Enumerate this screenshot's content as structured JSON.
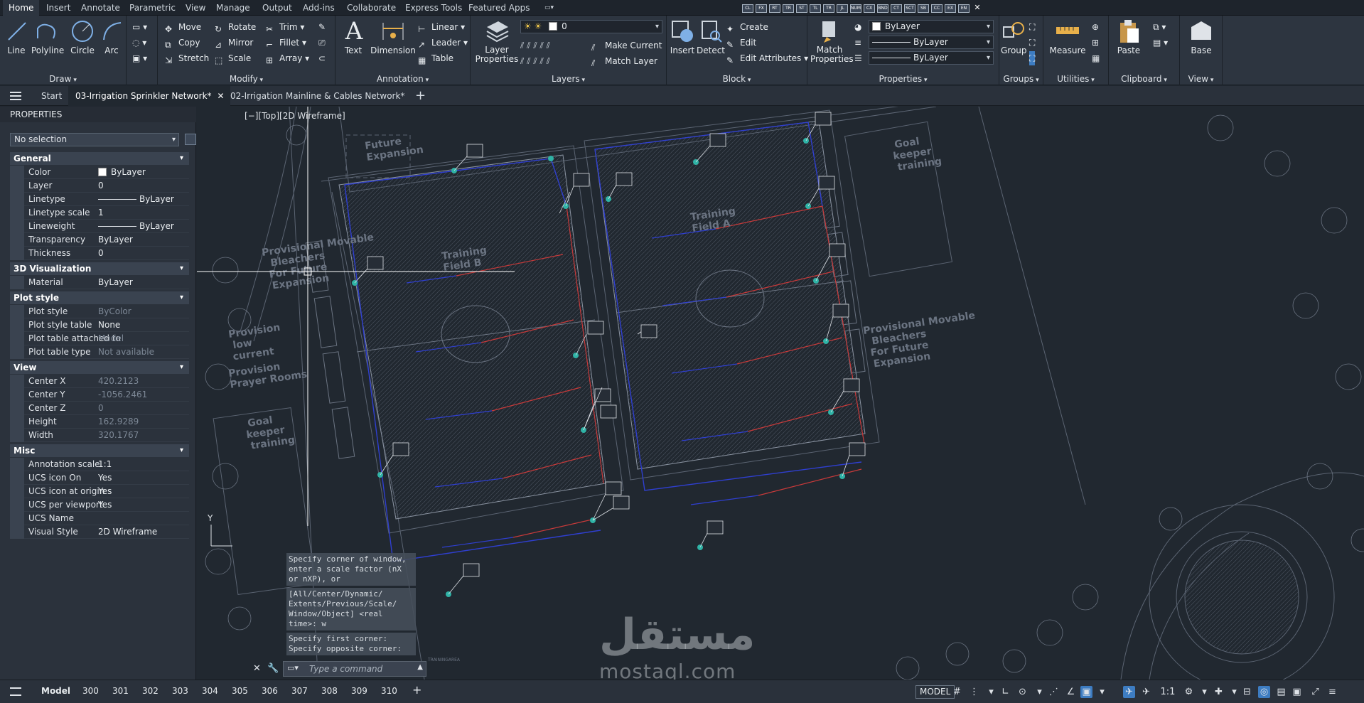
{
  "ribbon_tabs": [
    "Home",
    "Insert",
    "Annotate",
    "Parametric",
    "View",
    "Manage",
    "Output",
    "Add-ins",
    "Collaborate",
    "Express Tools",
    "Featured Apps"
  ],
  "qat_buttons": [
    "CL",
    "FX",
    "RT",
    "TR",
    "ST",
    "TL",
    "TR",
    "JL",
    "NUM",
    "CX",
    "BND",
    "CT",
    "SCT",
    "SB",
    "CC",
    "EX",
    "EN"
  ],
  "draw": {
    "title": "Draw",
    "line": "Line",
    "polyline": "Polyline",
    "circle": "Circle",
    "arc": "Arc"
  },
  "modify": {
    "title": "Modify",
    "move": "Move",
    "rotate": "Rotate",
    "trim": "Trim",
    "copy": "Copy",
    "mirror": "Mirror",
    "fillet": "Fillet",
    "stretch": "Stretch",
    "scale": "Scale",
    "array": "Array"
  },
  "annotation": {
    "title": "Annotation",
    "text": "Text",
    "dimension": "Dimension",
    "linear": "Linear",
    "leader": "Leader",
    "table": "Table"
  },
  "layers": {
    "title": "Layers",
    "layer_properties": "Layer Properties",
    "current_layer": "0",
    "make_current": "Make Current",
    "match_layer": "Match Layer"
  },
  "block": {
    "title": "Block",
    "insert": "Insert",
    "detect": "Detect",
    "create": "Create",
    "edit": "Edit",
    "edit_attributes": "Edit Attributes"
  },
  "properties": {
    "title": "Properties",
    "match_properties": "Match Properties",
    "color": "ByLayer",
    "linetype": "ByLayer",
    "lineweight": "ByLayer"
  },
  "groups": {
    "title": "Groups",
    "group": "Group"
  },
  "utilities": {
    "title": "Utilities",
    "measure": "Measure"
  },
  "clipboard": {
    "title": "Clipboard",
    "paste": "Paste"
  },
  "view_panel": {
    "title": "View",
    "base": "Base"
  },
  "doc_tabs": [
    "Start",
    "03-Irrigation Sprinkler Network*",
    "02-Irrigation Mainline & Cables Network*"
  ],
  "palette": {
    "title": "PROPERTIES",
    "selection": "No selection",
    "general": {
      "title": "General",
      "rows": [
        {
          "name": "Color",
          "value": "ByLayer"
        },
        {
          "name": "Layer",
          "value": "0"
        },
        {
          "name": "Linetype",
          "value": "ByLayer"
        },
        {
          "name": "Linetype scale",
          "value": "1"
        },
        {
          "name": "Lineweight",
          "value": "ByLayer"
        },
        {
          "name": "Transparency",
          "value": "ByLayer"
        },
        {
          "name": "Thickness",
          "value": "0"
        }
      ]
    },
    "viz": {
      "title": "3D Visualization",
      "rows": [
        {
          "name": "Material",
          "value": "ByLayer"
        }
      ]
    },
    "plot": {
      "title": "Plot style",
      "rows": [
        {
          "name": "Plot style",
          "value": "ByColor"
        },
        {
          "name": "Plot style table",
          "value": "None"
        },
        {
          "name": "Plot table attached to",
          "value": "Model"
        },
        {
          "name": "Plot table type",
          "value": "Not available"
        }
      ]
    },
    "view": {
      "title": "View",
      "rows": [
        {
          "name": "Center X",
          "value": "420.2123"
        },
        {
          "name": "Center Y",
          "value": "-1056.2461"
        },
        {
          "name": "Center Z",
          "value": "0"
        },
        {
          "name": "Height",
          "value": "162.9289"
        },
        {
          "name": "Width",
          "value": "320.1767"
        }
      ]
    },
    "misc": {
      "title": "Misc",
      "rows": [
        {
          "name": "Annotation scale",
          "value": "1:1"
        },
        {
          "name": "UCS icon On",
          "value": "Yes"
        },
        {
          "name": "UCS icon at origin",
          "value": "Yes"
        },
        {
          "name": "UCS per viewport",
          "value": "Yes"
        },
        {
          "name": "UCS Name",
          "value": ""
        },
        {
          "name": "Visual Style",
          "value": "2D Wireframe"
        }
      ]
    }
  },
  "viewport_label": "[−][Top][2D Wireframe]",
  "drawing_labels": {
    "future_expansion": [
      "Future",
      "Expansion"
    ],
    "goal_keeper_right": [
      "Goal",
      "keeper",
      "training"
    ],
    "goal_keeper_left": [
      "Goal",
      "keeper",
      "training"
    ],
    "training_a": [
      "Training",
      "Field A"
    ],
    "training_b": [
      "Training",
      "Field B"
    ],
    "bleachers_left": [
      "Provisional Movable",
      "Bleachers",
      "For Future",
      "Expansion"
    ],
    "bleachers_right": [
      "Provisional Movable",
      "Bleachers",
      "For Future",
      "Expansion"
    ],
    "provision_low": [
      "Provision",
      "low",
      "current"
    ],
    "provision_prayer": [
      "Provision",
      "Prayer Rooms"
    ],
    "small_note": "TRAININGAREA"
  },
  "ucs": {
    "y": "Y"
  },
  "command": {
    "history": [
      "Specify corner of window,\nenter a scale factor (nX\nor nXP), or",
      "[All/Center/Dynamic/\nExtents/Previous/Scale/\nWindow/Object] <real\ntime>: w",
      "Specify first corner:\nSpecify opposite corner:"
    ],
    "placeholder": "Type a command"
  },
  "watermark": {
    "arabic": "مستقل",
    "latin": "mostaql.com"
  },
  "layout_tabs": [
    "Model",
    "300",
    "301",
    "302",
    "303",
    "304",
    "305",
    "306",
    "307",
    "308",
    "309",
    "310"
  ],
  "status": {
    "model": "MODEL",
    "anno_scale": "1:1"
  },
  "colors": {
    "canvas": "#212830",
    "panel": "#2d3540",
    "accent": "#3d7cc1",
    "pipe_blue": "#2f3fd0",
    "pipe_red": "#c83a3a",
    "sprinkler": "#2fb3a6"
  }
}
